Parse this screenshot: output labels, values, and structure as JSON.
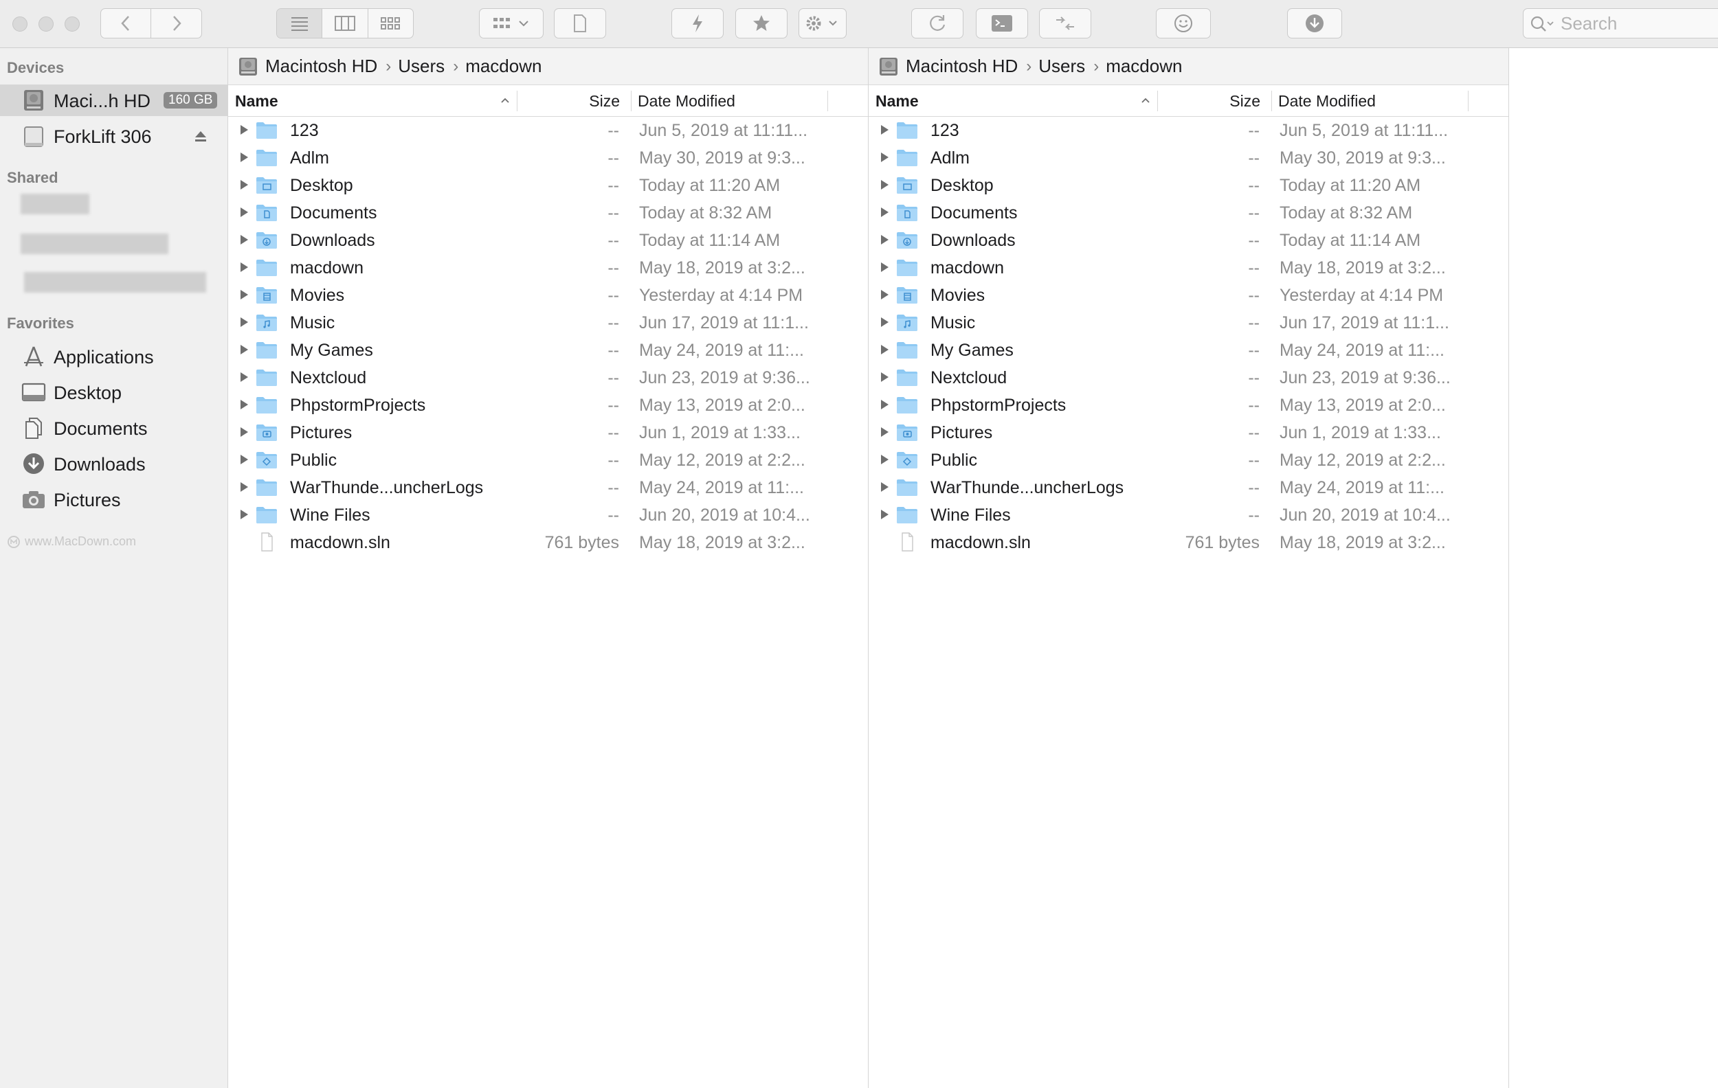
{
  "toolbar": {
    "search_placeholder": "Search"
  },
  "sidebar": {
    "devices_heading": "Devices",
    "devices": [
      {
        "label": "Maci...h HD",
        "badge": "160 GB"
      },
      {
        "label": "ForkLift 306"
      }
    ],
    "shared_heading": "Shared",
    "favorites_heading": "Favorites",
    "favorites": [
      {
        "label": "Applications"
      },
      {
        "label": "Desktop"
      },
      {
        "label": "Documents"
      },
      {
        "label": "Downloads"
      },
      {
        "label": "Pictures"
      }
    ],
    "watermark": "www.MacDown.com"
  },
  "left_pane": {
    "path": [
      "Macintosh HD",
      "Users",
      "macdown"
    ],
    "columns": {
      "name": "Name",
      "size": "Size",
      "date": "Date Modified"
    },
    "rows": [
      {
        "name": "123",
        "size": "--",
        "date": "Jun 5, 2019 at 11:11..."
      },
      {
        "name": "Adlm",
        "size": "--",
        "date": "May 30, 2019 at 9:3..."
      },
      {
        "name": "Desktop",
        "size": "--",
        "date": "Today at 11:20 AM"
      },
      {
        "name": "Documents",
        "size": "--",
        "date": "Today at 8:32 AM"
      },
      {
        "name": "Downloads",
        "size": "--",
        "date": "Today at 11:14 AM"
      },
      {
        "name": "macdown",
        "size": "--",
        "date": "May 18, 2019 at 3:2..."
      },
      {
        "name": "Movies",
        "size": "--",
        "date": "Yesterday at 4:14 PM"
      },
      {
        "name": "Music",
        "size": "--",
        "date": "Jun 17, 2019 at 11:1..."
      },
      {
        "name": "My Games",
        "size": "--",
        "date": "May 24, 2019 at 11:..."
      },
      {
        "name": "Nextcloud",
        "size": "--",
        "date": "Jun 23, 2019 at 9:36..."
      },
      {
        "name": "PhpstormProjects",
        "size": "--",
        "date": "May 13, 2019 at 2:0..."
      },
      {
        "name": "Pictures",
        "size": "--",
        "date": "Jun 1, 2019 at 1:33..."
      },
      {
        "name": "Public",
        "size": "--",
        "date": "May 12, 2019 at 2:2..."
      },
      {
        "name": "WarThunde...uncherLogs",
        "size": "--",
        "date": "May 24, 2019 at 11:..."
      },
      {
        "name": "Wine Files",
        "size": "--",
        "date": "Jun 20, 2019 at 10:4..."
      },
      {
        "name": "macdown.sln",
        "size": "761 bytes",
        "date": "May 18, 2019 at 3:2..."
      }
    ]
  },
  "right_pane": {
    "path": [
      "Macintosh HD",
      "Users",
      "macdown"
    ],
    "columns": {
      "name": "Name",
      "size": "Size",
      "date": "Date Modified"
    },
    "rows": [
      {
        "name": "123",
        "size": "--",
        "date": "Jun 5, 2019 at 11:11..."
      },
      {
        "name": "Adlm",
        "size": "--",
        "date": "May 30, 2019 at 9:3..."
      },
      {
        "name": "Desktop",
        "size": "--",
        "date": "Today at 11:20 AM"
      },
      {
        "name": "Documents",
        "size": "--",
        "date": "Today at 8:32 AM"
      },
      {
        "name": "Downloads",
        "size": "--",
        "date": "Today at 11:14 AM"
      },
      {
        "name": "macdown",
        "size": "--",
        "date": "May 18, 2019 at 3:2..."
      },
      {
        "name": "Movies",
        "size": "--",
        "date": "Yesterday at 4:14 PM"
      },
      {
        "name": "Music",
        "size": "--",
        "date": "Jun 17, 2019 at 11:1..."
      },
      {
        "name": "My Games",
        "size": "--",
        "date": "May 24, 2019 at 11:..."
      },
      {
        "name": "Nextcloud",
        "size": "--",
        "date": "Jun 23, 2019 at 9:36..."
      },
      {
        "name": "PhpstormProjects",
        "size": "--",
        "date": "May 13, 2019 at 2:0..."
      },
      {
        "name": "Pictures",
        "size": "--",
        "date": "Jun 1, 2019 at 1:33..."
      },
      {
        "name": "Public",
        "size": "--",
        "date": "May 12, 2019 at 2:2..."
      },
      {
        "name": "WarThunde...uncherLogs",
        "size": "--",
        "date": "May 24, 2019 at 11:..."
      },
      {
        "name": "Wine Files",
        "size": "--",
        "date": "Jun 20, 2019 at 10:4..."
      },
      {
        "name": "macdown.sln",
        "size": "761 bytes",
        "date": "May 18, 2019 at 3:2..."
      }
    ]
  }
}
